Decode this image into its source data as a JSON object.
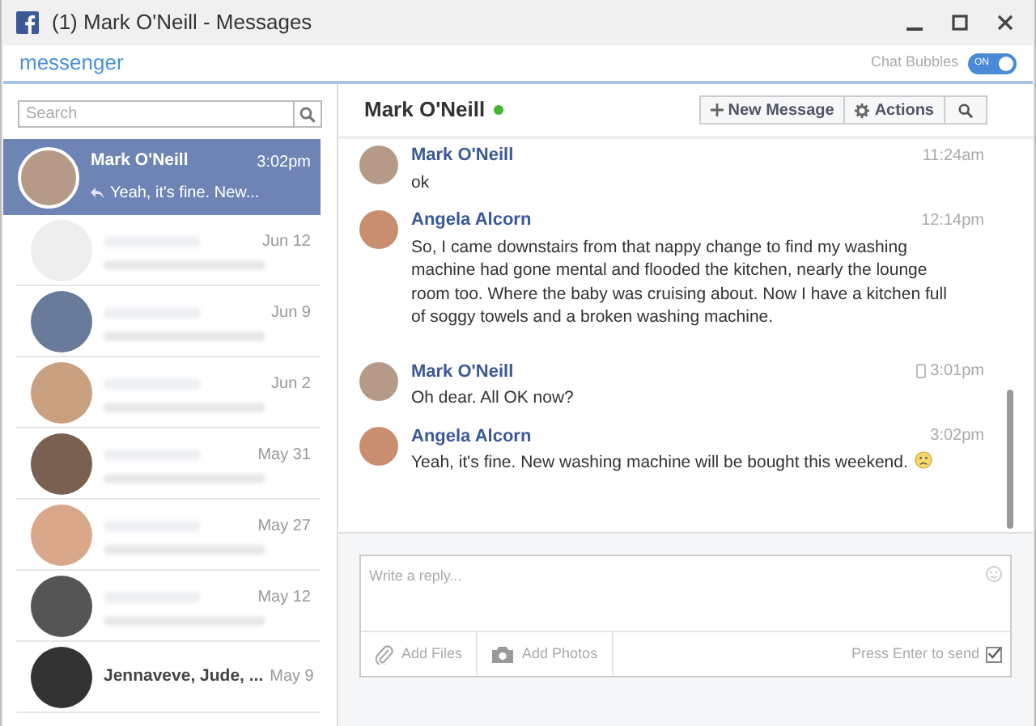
{
  "window": {
    "title": "(1) Mark O'Neill - Messages"
  },
  "header": {
    "brand": "messenger",
    "chat_bubbles": {
      "label": "Chat Bubbles",
      "toggle_label": "ON",
      "on": true
    }
  },
  "search": {
    "placeholder": "Search"
  },
  "conversations": [
    {
      "name": "Mark O'Neill",
      "preview": "Yeah, it's fine. New...",
      "time": "3:02pm",
      "selected": true
    },
    {
      "time": "Jun 12",
      "selected": false
    },
    {
      "time": "Jun 9",
      "selected": false
    },
    {
      "time": "Jun 2",
      "selected": false
    },
    {
      "time": "May 31",
      "selected": false
    },
    {
      "time": "May 27",
      "selected": false
    },
    {
      "time": "May 12",
      "selected": false
    },
    {
      "name": "Jennaveve, Jude, ...",
      "time": "May 9",
      "selected": false
    }
  ],
  "conversation": {
    "name": "Mark O'Neill",
    "online": true,
    "buttons": [
      {
        "kind": "new",
        "label": "New Message"
      },
      {
        "kind": "actions",
        "label": "Actions"
      },
      {
        "kind": "search"
      }
    ]
  },
  "messages": [
    {
      "sender": "Mark O'Neill",
      "text": "ok",
      "time": "11:24am",
      "via_mobile": false,
      "emoji": false
    },
    {
      "sender": "Angela Alcorn",
      "text": "So, I came downstairs from that nappy change to find my washing machine had gone mental and flooded the kitchen, nearly the lounge room too. Where the baby was cruising about. Now I have a kitchen full of soggy towels and a broken washing machine.",
      "time": "12:14pm",
      "via_mobile": false,
      "emoji": false
    },
    {
      "sender": "Mark O'Neill",
      "text": "Oh dear. All OK now?",
      "time": "3:01pm",
      "via_mobile": true,
      "emoji": false
    },
    {
      "sender": "Angela Alcorn",
      "text": "Yeah, it's fine. New washing machine will be bought this weekend.",
      "time": "3:02pm",
      "via_mobile": false,
      "emoji": true
    }
  ],
  "composer": {
    "placeholder": "Write a reply...",
    "add_files": "Add Files",
    "add_photos": "Add Photos",
    "enter_label": "Press Enter to send",
    "enter_checked": true
  }
}
